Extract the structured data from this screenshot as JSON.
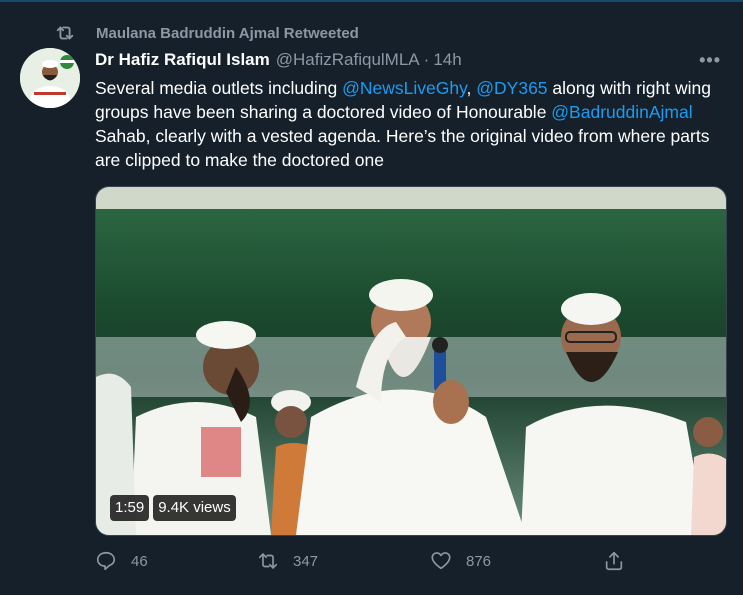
{
  "retweet_context": {
    "label": "Maulana Badruddin Ajmal Retweeted",
    "icon": "retweet-icon"
  },
  "author": {
    "name": "Dr Hafiz Rafiqul Islam",
    "handle": "@HafizRafiqulMLA",
    "separator": "·",
    "time": "14h"
  },
  "more_label": "•••",
  "tweet": {
    "t1": "Several media outlets including ",
    "m1": "@NewsLiveGhy",
    "t2": ", ",
    "m2": "@DY365",
    "t3": " along with right wing groups have been sharing a doctored video of Honourable ",
    "m3": "@BadruddinAjmal",
    "t4": " Sahab, clearly with a vested agenda. Here’s the original video from where parts are clipped to make the doctored one"
  },
  "video": {
    "duration": "1:59",
    "views": "9.4K views"
  },
  "actions": {
    "reply": {
      "icon": "reply-icon",
      "count": "46"
    },
    "retweet": {
      "icon": "retweet-icon",
      "count": "347"
    },
    "like": {
      "icon": "like-icon",
      "count": "876"
    },
    "share": {
      "icon": "share-icon"
    }
  },
  "colors": {
    "background": "#15202b",
    "text": "#ffffff",
    "muted": "#8b98a5",
    "link": "#1d9bf0"
  }
}
